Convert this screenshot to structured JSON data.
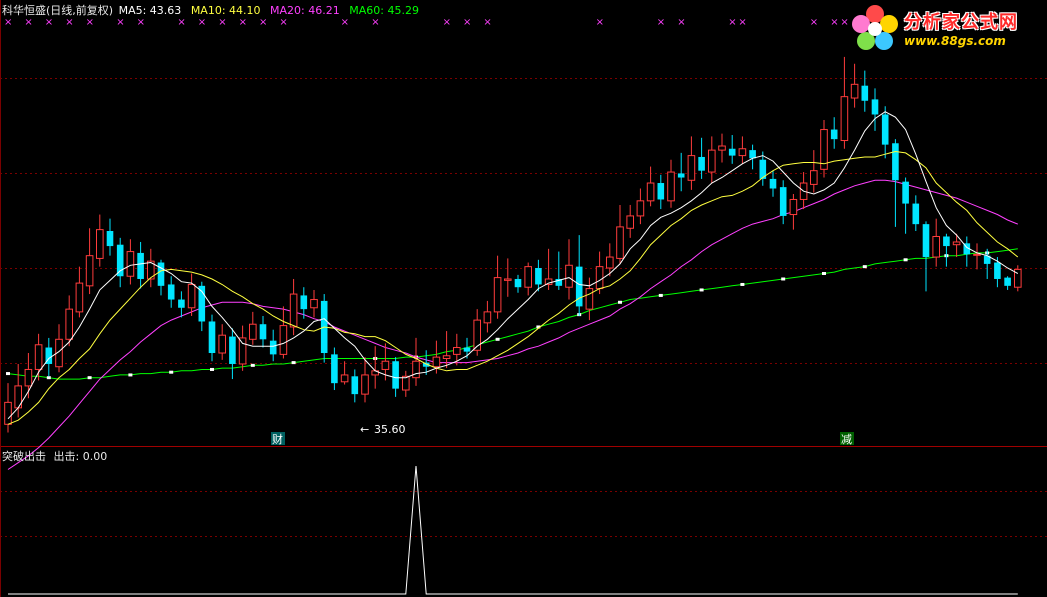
{
  "header": {
    "stock_title": "科华恒盛(日线,前复权)",
    "ma5": "MA5: 43.63",
    "ma10": "MA10: 44.10",
    "ma20": "MA20: 46.21",
    "ma60": "MA60: 45.29"
  },
  "lower_panel": {
    "indicator_title": "突破出击",
    "value_text": "出击: 0.00"
  },
  "annotations": {
    "low_price": "35.60",
    "marker_cai": "财",
    "marker_jian": "减"
  },
  "watermark": {
    "site_name": "分析家公式网",
    "url": "www.88gs.com"
  },
  "colors": {
    "background": "#000000",
    "up_candle": "#ff3c3c",
    "down_candle": "#00e5ff",
    "ma5": "#ffffff",
    "ma10": "#ffff40",
    "ma20": "#ff40ff",
    "ma60": "#00ff00",
    "grid": "#7a0000",
    "marks": "#ff40ff"
  },
  "chart_data": [
    {
      "type": "candlestick",
      "title": "科华恒盛(日线,前复权)",
      "xlabel": "",
      "ylabel": "",
      "ylim": [
        33.0,
        63.2
      ],
      "candles": [
        [
          34.0,
          35.6,
          33.4,
          37.0
        ],
        [
          35.2,
          36.8,
          34.5,
          38.4
        ],
        [
          36.8,
          38.0,
          35.9,
          39.2
        ],
        [
          38.0,
          39.8,
          37.2,
          40.6
        ],
        [
          39.6,
          38.4,
          37.5,
          40.3
        ],
        [
          38.2,
          40.2,
          37.8,
          41.3
        ],
        [
          40.2,
          42.4,
          39.7,
          43.4
        ],
        [
          42.2,
          44.3,
          41.8,
          45.5
        ],
        [
          44.1,
          46.3,
          43.5,
          48.3
        ],
        [
          46.1,
          48.2,
          45.5,
          49.3
        ],
        [
          48.1,
          47.0,
          46.3,
          49.0
        ],
        [
          47.1,
          44.8,
          44.0,
          47.6
        ],
        [
          44.8,
          46.6,
          44.2,
          47.5
        ],
        [
          46.5,
          44.6,
          43.9,
          47.3
        ],
        [
          44.6,
          45.9,
          44.0,
          46.8
        ],
        [
          45.8,
          44.1,
          43.4,
          46.0
        ],
        [
          44.2,
          43.1,
          42.5,
          44.8
        ],
        [
          43.1,
          42.5,
          41.8,
          43.7
        ],
        [
          42.5,
          44.2,
          41.9,
          45.0
        ],
        [
          44.1,
          41.5,
          40.8,
          44.4
        ],
        [
          41.5,
          39.2,
          38.6,
          42.0
        ],
        [
          39.2,
          40.5,
          38.7,
          41.3
        ],
        [
          40.4,
          38.4,
          37.3,
          41.0
        ],
        [
          38.4,
          40.3,
          37.9,
          41.2
        ],
        [
          40.2,
          41.3,
          39.8,
          42.2
        ],
        [
          41.3,
          40.2,
          39.6,
          41.9
        ],
        [
          40.1,
          39.1,
          38.6,
          40.9
        ],
        [
          39.1,
          41.2,
          38.8,
          42.6
        ],
        [
          41.1,
          43.5,
          40.5,
          44.6
        ],
        [
          43.4,
          42.4,
          41.7,
          44.0
        ],
        [
          42.5,
          43.1,
          41.8,
          43.8
        ],
        [
          43.0,
          39.2,
          38.5,
          43.5
        ],
        [
          39.1,
          37.0,
          36.5,
          39.6
        ],
        [
          37.1,
          37.6,
          36.9,
          38.6
        ],
        [
          37.5,
          36.2,
          35.6,
          38.0
        ],
        [
          36.2,
          37.6,
          35.6,
          38.9
        ],
        [
          37.6,
          37.9,
          36.6,
          39.7
        ],
        [
          38.0,
          38.6,
          37.2,
          39.9
        ],
        [
          38.6,
          36.6,
          36.0,
          38.9
        ],
        [
          36.5,
          37.5,
          36.0,
          37.9
        ],
        [
          37.4,
          38.6,
          36.8,
          40.3
        ],
        [
          38.5,
          38.2,
          37.6,
          39.4
        ],
        [
          38.2,
          38.9,
          37.7,
          40.1
        ],
        [
          38.8,
          39.0,
          38.1,
          40.8
        ],
        [
          39.1,
          39.6,
          38.3,
          40.6
        ],
        [
          39.6,
          39.3,
          38.8,
          40.3
        ],
        [
          39.4,
          41.6,
          39.0,
          42.4
        ],
        [
          41.4,
          42.2,
          40.7,
          43.0
        ],
        [
          42.2,
          44.7,
          41.7,
          46.3
        ],
        [
          44.5,
          44.6,
          43.3,
          46.1
        ],
        [
          44.6,
          44.0,
          43.6,
          44.9
        ],
        [
          44.0,
          45.5,
          43.4,
          45.8
        ],
        [
          45.4,
          44.2,
          43.7,
          46.0
        ],
        [
          44.2,
          44.6,
          43.8,
          46.8
        ],
        [
          44.6,
          44.1,
          43.8,
          46.6
        ],
        [
          44.0,
          45.6,
          43.1,
          47.5
        ],
        [
          45.5,
          42.6,
          41.9,
          47.8
        ],
        [
          42.4,
          43.9,
          41.6,
          44.7
        ],
        [
          43.9,
          45.5,
          43.5,
          46.6
        ],
        [
          45.4,
          46.2,
          44.8,
          47.2
        ],
        [
          46.1,
          48.4,
          45.7,
          50.0
        ],
        [
          48.3,
          49.2,
          47.6,
          50.0
        ],
        [
          49.2,
          50.3,
          48.6,
          51.2
        ],
        [
          50.3,
          51.6,
          49.9,
          52.8
        ],
        [
          51.6,
          50.4,
          49.7,
          52.2
        ],
        [
          50.3,
          52.4,
          49.8,
          53.3
        ],
        [
          52.3,
          52.0,
          51.0,
          53.8
        ],
        [
          51.8,
          53.6,
          51.1,
          55.0
        ],
        [
          53.5,
          52.5,
          51.9,
          54.9
        ],
        [
          52.4,
          54.0,
          51.6,
          55.0
        ],
        [
          54.0,
          54.3,
          53.1,
          55.2
        ],
        [
          54.1,
          53.6,
          53.0,
          55.1
        ],
        [
          53.6,
          54.1,
          53.0,
          55.0
        ],
        [
          54.0,
          53.4,
          52.6,
          54.4
        ],
        [
          53.3,
          51.9,
          51.4,
          53.9
        ],
        [
          51.9,
          51.2,
          50.6,
          52.5
        ],
        [
          51.3,
          49.2,
          48.6,
          51.8
        ],
        [
          49.3,
          50.4,
          48.2,
          50.8
        ],
        [
          50.4,
          51.6,
          49.7,
          52.4
        ],
        [
          51.5,
          52.5,
          50.9,
          54.0
        ],
        [
          52.6,
          55.5,
          52.0,
          56.2
        ],
        [
          55.5,
          54.8,
          54.1,
          56.4
        ],
        [
          54.7,
          57.9,
          54.1,
          60.8
        ],
        [
          57.8,
          58.8,
          57.1,
          60.3
        ],
        [
          58.7,
          57.6,
          56.8,
          59.8
        ],
        [
          57.7,
          56.6,
          55.4,
          58.5
        ],
        [
          56.6,
          54.4,
          53.4,
          57.2
        ],
        [
          54.5,
          51.8,
          48.4,
          54.8
        ],
        [
          51.7,
          50.1,
          47.9,
          52.0
        ],
        [
          50.1,
          48.6,
          48.1,
          50.7
        ],
        [
          48.6,
          46.2,
          43.7,
          48.8
        ],
        [
          46.2,
          47.7,
          45.5,
          49.0
        ],
        [
          47.7,
          47.0,
          45.5,
          47.9
        ],
        [
          47.1,
          47.3,
          46.2,
          47.9
        ],
        [
          47.2,
          46.4,
          45.5,
          47.7
        ],
        [
          46.4,
          46.4,
          45.3,
          47.2
        ],
        [
          46.3,
          45.7,
          44.6,
          46.8
        ],
        [
          45.8,
          44.6,
          44.0,
          46.2
        ],
        [
          44.7,
          44.1,
          43.8,
          44.8
        ],
        [
          44.0,
          45.3,
          43.7,
          45.6
        ]
      ],
      "ma_series": [
        {
          "name": "MA5",
          "values": [
            34.4,
            35.2,
            36.4,
            37.8,
            38.8,
            39.3,
            40.0,
            41.1,
            42.4,
            43.8,
            44.5,
            45.2,
            45.6,
            45.7,
            45.8,
            45.4,
            45.0,
            44.4,
            44.3,
            43.7,
            42.6,
            41.8,
            40.9,
            39.9,
            39.7,
            39.7,
            39.7,
            39.9,
            40.3,
            40.8,
            41.5,
            41.7,
            41.0,
            40.3,
            39.7,
            38.7,
            37.9,
            37.6,
            37.4,
            37.4,
            37.7,
            37.8,
            38.1,
            38.3,
            38.6,
            39.0,
            39.7,
            40.2,
            40.9,
            41.7,
            42.4,
            43.1,
            43.9,
            44.3,
            44.5,
            44.7,
            44.2,
            44.1,
            44.5,
            45.0,
            45.7,
            46.8,
            47.5,
            48.5,
            49.1,
            49.4,
            49.8,
            50.3,
            50.9,
            51.6,
            52.0,
            52.5,
            53.0,
            53.4,
            53.6,
            53.2,
            52.4,
            51.6,
            51.0,
            50.8,
            51.1,
            51.6,
            52.7,
            54.0,
            55.4,
            56.3,
            56.8,
            56.4,
            55.5,
            53.7,
            51.7,
            49.8,
            48.5,
            47.8,
            46.9,
            46.5,
            46.3,
            45.9,
            45.4,
            45.0
          ]
        },
        {
          "name": "MA10",
          "values": [
            34.0,
            34.3,
            34.9,
            35.6,
            36.6,
            37.4,
            38.0,
            38.8,
            39.5,
            40.6,
            41.6,
            42.4,
            43.2,
            44.0,
            44.7,
            45.2,
            45.3,
            45.2,
            45.1,
            44.9,
            44.6,
            44.2,
            43.7,
            43.3,
            42.8,
            42.4,
            41.9,
            41.5,
            41.2,
            40.9,
            40.8,
            41.1,
            41.0,
            40.7,
            40.6,
            40.4,
            40.4,
            40.1,
            39.6,
            39.1,
            38.8,
            38.4,
            38.1,
            37.9,
            38.0,
            38.0,
            38.3,
            38.6,
            39.0,
            39.4,
            39.9,
            40.4,
            41.0,
            41.6,
            42.1,
            42.7,
            43.2,
            43.5,
            43.9,
            44.1,
            44.6,
            45.2,
            46.1,
            47.1,
            47.8,
            48.5,
            49.0,
            49.6,
            50.0,
            50.3,
            50.6,
            50.7,
            51.0,
            51.4,
            52.0,
            52.5,
            52.9,
            53.0,
            53.1,
            53.1,
            53.0,
            53.2,
            53.3,
            53.4,
            53.5,
            53.5,
            53.7,
            53.9,
            53.8,
            53.3,
            52.7,
            51.6,
            50.9,
            50.2,
            49.6,
            48.7,
            48.0,
            47.3,
            46.8,
            46.2
          ]
        },
        {
          "name": "MA20",
          "values": [
            30.7,
            31.2,
            31.7,
            32.3,
            33.0,
            33.8,
            34.6,
            35.5,
            36.4,
            37.3,
            38.0,
            38.7,
            39.3,
            40.0,
            40.6,
            41.2,
            41.6,
            41.9,
            42.2,
            42.5,
            42.7,
            42.9,
            42.9,
            42.9,
            42.8,
            42.6,
            42.5,
            42.4,
            42.2,
            42.0,
            41.7,
            41.5,
            41.1,
            40.8,
            40.5,
            40.2,
            39.9,
            39.6,
            39.4,
            39.2,
            38.9,
            38.7,
            38.5,
            38.5,
            38.5,
            38.5,
            38.6,
            38.7,
            38.8,
            39.0,
            39.2,
            39.5,
            39.7,
            40.0,
            40.3,
            40.7,
            41.0,
            41.3,
            41.6,
            41.9,
            42.4,
            42.8,
            43.3,
            43.9,
            44.4,
            44.9,
            45.5,
            46.0,
            46.6,
            47.1,
            47.5,
            47.9,
            48.3,
            48.6,
            48.8,
            49.0,
            49.3,
            49.5,
            49.8,
            50.1,
            50.4,
            50.8,
            51.1,
            51.4,
            51.6,
            51.8,
            51.8,
            51.7,
            51.5,
            51.3,
            51.1,
            50.9,
            50.7,
            50.5,
            50.2,
            49.9,
            49.6,
            49.3,
            48.9,
            48.6
          ]
        },
        {
          "name": "MA60",
          "values": [
            37.7,
            37.6,
            37.5,
            37.5,
            37.4,
            37.3,
            37.3,
            37.3,
            37.4,
            37.4,
            37.5,
            37.6,
            37.6,
            37.7,
            37.7,
            37.8,
            37.8,
            37.9,
            37.9,
            38.0,
            38.0,
            38.1,
            38.1,
            38.2,
            38.3,
            38.3,
            38.4,
            38.4,
            38.5,
            38.6,
            38.7,
            38.8,
            38.8,
            38.8,
            38.8,
            38.8,
            38.8,
            38.8,
            38.8,
            38.9,
            38.9,
            39.0,
            39.1,
            39.3,
            39.4,
            39.6,
            39.8,
            40.0,
            40.2,
            40.4,
            40.6,
            40.8,
            41.1,
            41.3,
            41.5,
            41.8,
            42.0,
            42.3,
            42.5,
            42.7,
            42.9,
            43.1,
            43.2,
            43.3,
            43.4,
            43.5,
            43.6,
            43.7,
            43.8,
            43.9,
            44.0,
            44.1,
            44.2,
            44.3,
            44.4,
            44.5,
            44.6,
            44.7,
            44.8,
            44.9,
            45.0,
            45.1,
            45.3,
            45.4,
            45.5,
            45.7,
            45.8,
            45.9,
            46.0,
            46.1,
            46.1,
            46.2,
            46.3,
            46.3,
            46.4,
            46.5,
            46.5,
            46.6,
            46.7,
            46.8
          ]
        }
      ],
      "x_marks": [
        0,
        2,
        4,
        6,
        8,
        11,
        13,
        17,
        19,
        21,
        23,
        25,
        27,
        33,
        36,
        43,
        45,
        47,
        58,
        64,
        66,
        71,
        72,
        79,
        81,
        82,
        85
      ]
    },
    {
      "type": "line",
      "title": "突破出击",
      "series": [
        {
          "name": "出击",
          "values": [
            0,
            0,
            0,
            0,
            0,
            0,
            0,
            0,
            0,
            0,
            0,
            0,
            0,
            0,
            0,
            0,
            0,
            0,
            0,
            0,
            0,
            0,
            0,
            0,
            0,
            0,
            0,
            0,
            0,
            0,
            0,
            0,
            0,
            0,
            0,
            0,
            0,
            0,
            0,
            0,
            1,
            0,
            0,
            0,
            0,
            0,
            0,
            0,
            0,
            0,
            0,
            0,
            0,
            0,
            0,
            0,
            0,
            0,
            0,
            0,
            0,
            0,
            0,
            0,
            0,
            0,
            0,
            0,
            0,
            0,
            0,
            0,
            0,
            0,
            0,
            0,
            0,
            0,
            0,
            0,
            0,
            0,
            0,
            0,
            0,
            0,
            0,
            0,
            0,
            0,
            0,
            0,
            0,
            0,
            0,
            0,
            0,
            0,
            0,
            0
          ]
        }
      ],
      "ylim": [
        0,
        1
      ]
    }
  ]
}
